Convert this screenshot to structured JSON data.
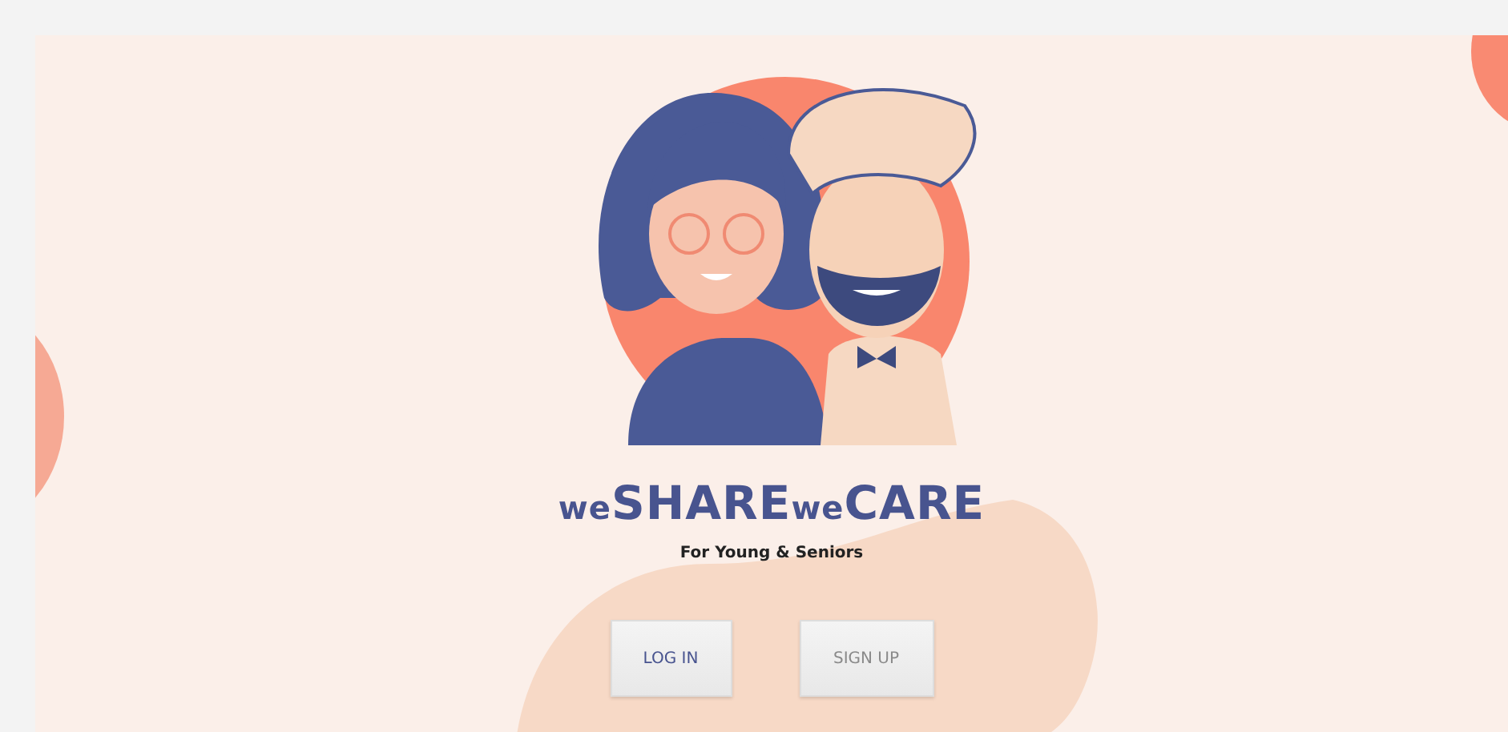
{
  "logo": {
    "parts": [
      {
        "text": "we",
        "kind": "small"
      },
      {
        "text": "SHARE",
        "kind": "large"
      },
      {
        "text": "we",
        "kind": "small"
      },
      {
        "text": "CARE",
        "kind": "large"
      }
    ]
  },
  "tagline": "For Young & Seniors",
  "buttons": [
    {
      "label": "LOG IN",
      "kind": "login"
    },
    {
      "label": "SIGN UP",
      "kind": "signup"
    }
  ]
}
